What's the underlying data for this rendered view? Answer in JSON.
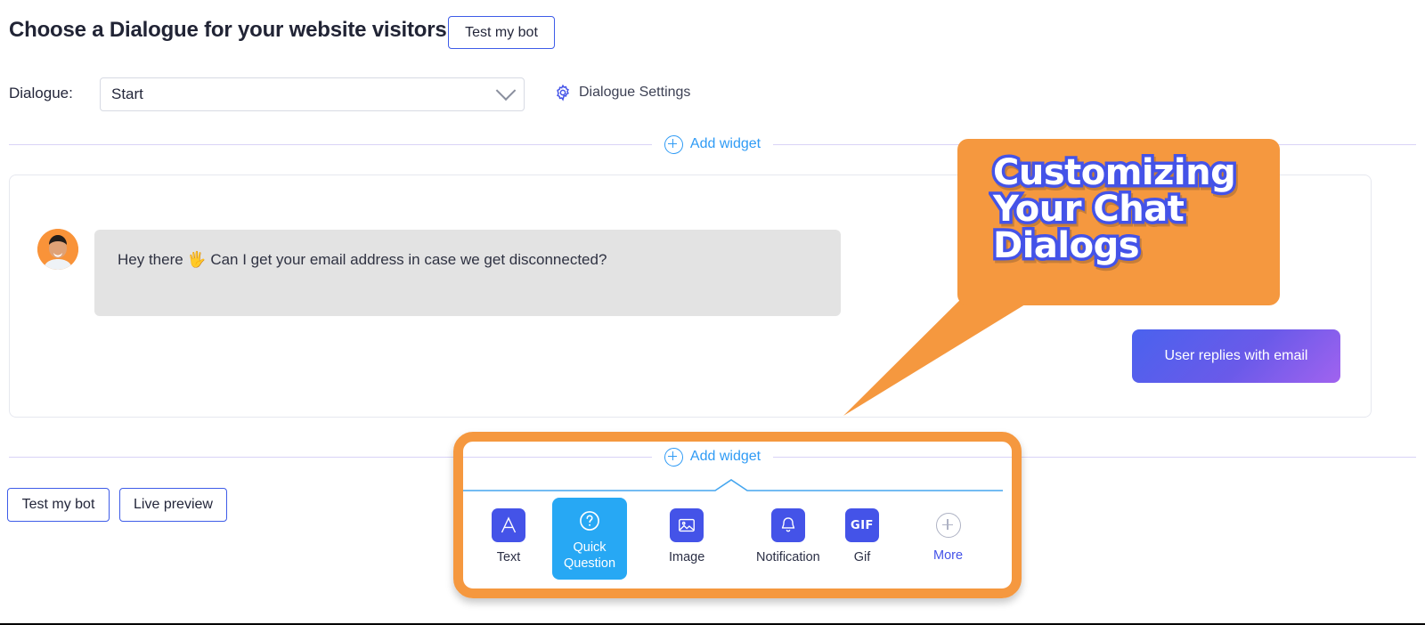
{
  "header": {
    "title": "Choose a Dialogue for your website visitors",
    "test_bot_label": "Test my bot"
  },
  "dialogue": {
    "label": "Dialogue:",
    "selected": "Start",
    "settings_label": "Dialogue Settings",
    "settings_icon": "gear-icon",
    "chevron_icon": "chevron-down-icon"
  },
  "add_widget": {
    "label": "Add widget",
    "icon": "circle-plus-icon"
  },
  "conversation": {
    "avatar_alt": "agent-avatar",
    "bot_message": "Hey there 🖐 Can I get your email address in case we get disconnected?",
    "user_reply": "User replies with email"
  },
  "footer": {
    "test_bot_label": "Test my bot",
    "live_preview_label": "Live preview"
  },
  "widget_picker": {
    "add_widget_label": "Add widget",
    "tiles": [
      {
        "label": "Text",
        "icon": "letter-a-icon",
        "active": false
      },
      {
        "label": "Quick\nQuestion",
        "line1": "Quick",
        "line2": "Question",
        "icon": "question-mark-circle-icon",
        "active": true
      },
      {
        "label": "Image",
        "icon": "image-icon",
        "active": false
      },
      {
        "label": "Notification",
        "icon": "bell-icon",
        "active": false
      },
      {
        "label": "Gif",
        "icon": "gif-icon",
        "glyph": "GIF",
        "active": false
      },
      {
        "label": "More",
        "icon": "circle-plus-icon",
        "active": false
      }
    ]
  },
  "annotation": {
    "line1": "Customizing",
    "line2": "Your Chat",
    "line3": "Dialogs"
  },
  "colors": {
    "accent_blue": "#4453e8",
    "link_blue": "#2f9bf5",
    "active_tile": "#27a8f4",
    "annotation_orange": "#f5983f",
    "divider_lavender": "#d9d3f7",
    "bot_bubble_grey": "#e3e3e3"
  }
}
